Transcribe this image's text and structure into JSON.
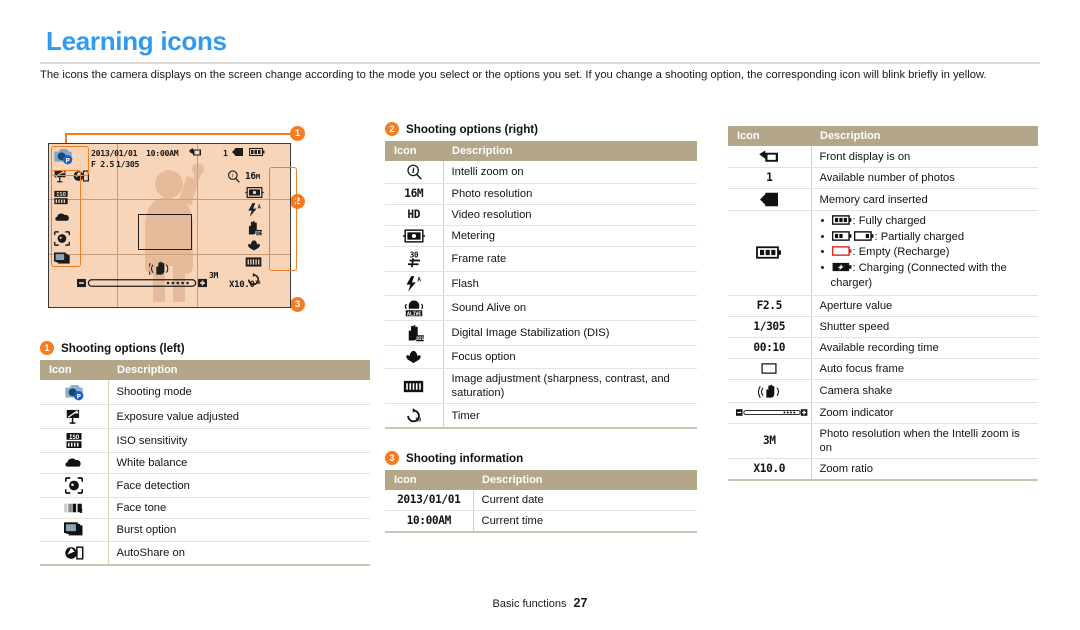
{
  "page": {
    "title": "Learning icons",
    "intro": "The icons the camera displays on the screen change according to the mode you select or the options you set. If you change a shooting option, the corresponding icon will blink briefly in yellow.",
    "footer_label": "Basic functions",
    "footer_page": "27",
    "accent_blue": "#2f9bf0",
    "accent_orange": "#f57c20",
    "table_header_bg": "#b3a689",
    "screen_bg": "#f8d5b8"
  },
  "camera_screen": {
    "callouts": [
      {
        "num": "1",
        "target": "shooting options (left)"
      },
      {
        "num": "2",
        "target": "shooting options (right)"
      },
      {
        "num": "3",
        "target": "shooting information"
      }
    ],
    "osd": {
      "date": "2013/01/01",
      "time": "10:00AM",
      "aperture": "F 2.5",
      "shutter": "1/305",
      "photos_remaining": "1",
      "intelli_resolution": "3M",
      "zoom_ratio": "X10.0"
    },
    "left_icons": [
      "shooting-mode-icon",
      "exposure-value-icon",
      "autoshare-icon",
      "iso-icon",
      "white-balance-icon",
      "face-detection-icon",
      "burst-option-icon"
    ],
    "right_icons": [
      "intelli-zoom-icon",
      "photo-resolution-16m-icon",
      "video-resolution-hd-icon",
      "flash-auto-icon",
      "dis-icon",
      "focus-option-icon",
      "image-adjustment-icon",
      "timer-icon"
    ]
  },
  "tables": {
    "headers": {
      "icon": "Icon",
      "description": "Description"
    },
    "shooting_options_left": {
      "num": "1",
      "heading": "Shooting options (left)",
      "rows": [
        {
          "icon": "shooting-mode-icon",
          "glyph": "",
          "description": "Shooting mode"
        },
        {
          "icon": "exposure-value-icon",
          "glyph": "",
          "description": "Exposure value adjusted"
        },
        {
          "icon": "iso-sensitivity-icon",
          "glyph": "",
          "description": "ISO sensitivity"
        },
        {
          "icon": "white-balance-icon",
          "glyph": "",
          "description": "White balance"
        },
        {
          "icon": "face-detection-icon",
          "glyph": "",
          "description": "Face detection"
        },
        {
          "icon": "face-tone-icon",
          "glyph": "",
          "description": "Face tone"
        },
        {
          "icon": "burst-option-icon",
          "glyph": "",
          "description": "Burst option"
        },
        {
          "icon": "autoshare-icon",
          "glyph": "",
          "description": "AutoShare on"
        }
      ]
    },
    "shooting_options_right": {
      "num": "2",
      "heading": "Shooting options (right)",
      "rows": [
        {
          "icon": "intelli-zoom-icon",
          "glyph": "",
          "description": "Intelli zoom on"
        },
        {
          "icon": "photo-resolution-icon",
          "glyph": "16M",
          "description": "Photo resolution"
        },
        {
          "icon": "video-resolution-icon",
          "glyph": "HD",
          "description": "Video resolution"
        },
        {
          "icon": "metering-icon",
          "glyph": "",
          "description": "Metering"
        },
        {
          "icon": "frame-rate-icon",
          "glyph": "",
          "description": "Frame rate"
        },
        {
          "icon": "flash-icon",
          "glyph": "",
          "description": "Flash"
        },
        {
          "icon": "sound-alive-icon",
          "glyph": "",
          "description": "Sound Alive on"
        },
        {
          "icon": "dis-icon",
          "glyph": "",
          "description": "Digital Image Stabilization (DIS)"
        },
        {
          "icon": "focus-option-icon",
          "glyph": "",
          "description": "Focus option"
        },
        {
          "icon": "image-adjustment-icon",
          "glyph": "",
          "description": "Image adjustment (sharpness, contrast, and saturation)"
        },
        {
          "icon": "timer-icon",
          "glyph": "",
          "description": "Timer"
        }
      ]
    },
    "shooting_information": {
      "num": "3",
      "heading": "Shooting information",
      "rows": [
        {
          "icon": "current-date-text",
          "glyph": "2013/01/01",
          "description": "Current date"
        },
        {
          "icon": "current-time-text",
          "glyph": "10:00AM",
          "description": "Current time"
        }
      ]
    },
    "status_icons": {
      "rows": [
        {
          "icon": "front-display-icon",
          "glyph": "",
          "description": "Front display is on"
        },
        {
          "icon": "photos-remaining-text",
          "glyph": "1",
          "description": "Available number of photos"
        },
        {
          "icon": "memory-card-icon",
          "glyph": "",
          "description": "Memory card inserted"
        },
        {
          "icon": "battery-icon",
          "glyph": "",
          "description": "",
          "bullets": [
            {
              "icon": "battery-full-icon",
              "text": ": Fully charged"
            },
            {
              "icon": "battery-partial-icon",
              "text": ": Partially charged"
            },
            {
              "icon": "battery-empty-icon",
              "text": ": Empty (Recharge)"
            },
            {
              "icon": "battery-charging-icon",
              "text": ": Charging (Connected with the charger)"
            }
          ]
        },
        {
          "icon": "aperture-text",
          "glyph": "F2.5",
          "description": "Aperture value"
        },
        {
          "icon": "shutter-speed-text",
          "glyph": "1/305",
          "description": "Shutter speed"
        },
        {
          "icon": "recording-time-text",
          "glyph": "00:10",
          "description": "Available recording time"
        },
        {
          "icon": "auto-focus-frame-icon",
          "glyph": "",
          "description": "Auto focus frame"
        },
        {
          "icon": "camera-shake-icon",
          "glyph": "",
          "description": "Camera shake"
        },
        {
          "icon": "zoom-indicator-icon",
          "glyph": "",
          "description": "Zoom indicator"
        },
        {
          "icon": "intelli-resolution-text",
          "glyph": "3M",
          "description": "Photo resolution when the Intelli zoom is on"
        },
        {
          "icon": "zoom-ratio-text",
          "glyph": "X10.0",
          "description": "Zoom ratio"
        }
      ]
    }
  }
}
